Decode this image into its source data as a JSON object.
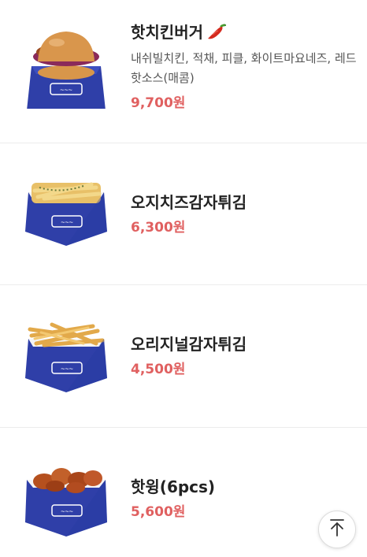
{
  "menu": {
    "items": [
      {
        "name": "핫치킨버거",
        "icon": "chili-pepper-icon",
        "description": "내쉬빌치킨, 적채, 피클, 화이트마요네즈, 레드핫소스(매콤)",
        "price": "9,700원",
        "image_icon": "burger-box-image"
      },
      {
        "name": "오지치즈감자튀김",
        "price": "6,300원",
        "image_icon": "cheese-fries-box-image"
      },
      {
        "name": "오리지널감자튀김",
        "price": "4,500원",
        "image_icon": "fries-box-image"
      },
      {
        "name": "핫윙(6pcs)",
        "price": "5,600원",
        "image_icon": "hot-wings-box-image"
      }
    ]
  },
  "scroll_top": {
    "icon": "arrow-up-to-top-icon"
  },
  "colors": {
    "price": "#e06060",
    "box_blue": "#2f3fa8",
    "divider": "#ececec"
  }
}
